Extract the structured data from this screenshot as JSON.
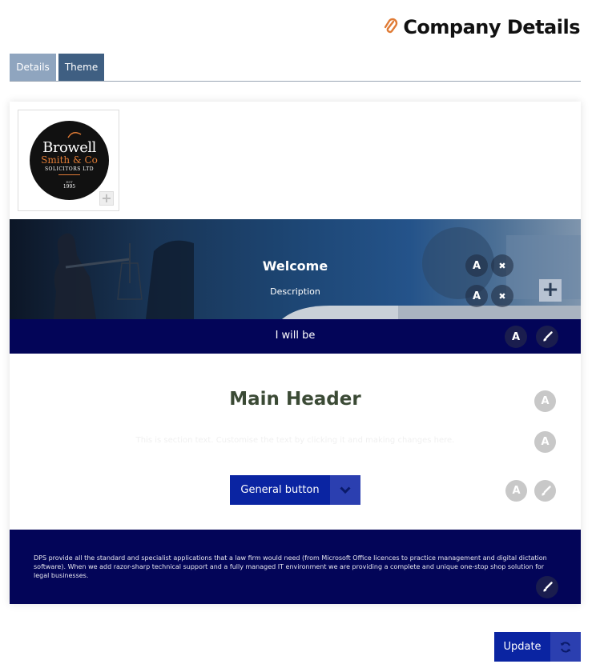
{
  "header": {
    "title": "Company Details",
    "icon": "paperclip-icon"
  },
  "tabs": [
    {
      "label": "Details",
      "active": true
    },
    {
      "label": "Theme",
      "active": false
    }
  ],
  "logo": {
    "line1": "Browell",
    "line2": "Smith & Co",
    "line3": "SOLICITORS LTD",
    "line4": "EST",
    "line5": "1995"
  },
  "banner": {
    "title": "Welcome",
    "description": "Description",
    "font_button": "A",
    "remove_button": "✖",
    "add_icon": "plus-icon"
  },
  "bar": {
    "text": "I will be",
    "font_button": "A",
    "brush_icon": "paintbrush-icon"
  },
  "main": {
    "header": "Main Header",
    "subtext": "This is section text. Customise the text by clicking it and making changes here.",
    "font_button": "A",
    "button_label": "General button",
    "button_menu_icon": "chevron-down-icon"
  },
  "footer": {
    "text": "DPS provide all the standard and specialist applications that a law firm would need (from Microsoft Office licences to practice management and digital dictation software). When we add razor-sharp technical support and a fully managed IT environment we are providing a complete and unique one-stop shop solution for legal businesses."
  },
  "actions": {
    "update_label": "Update",
    "refresh_icon": "refresh-icon"
  },
  "colors": {
    "navy": "#030558",
    "button_blue": "#0a24a2",
    "tab_active": "#8fa5bf",
    "tab_inactive": "#3f5f82",
    "clip_orange": "#e07b35"
  }
}
